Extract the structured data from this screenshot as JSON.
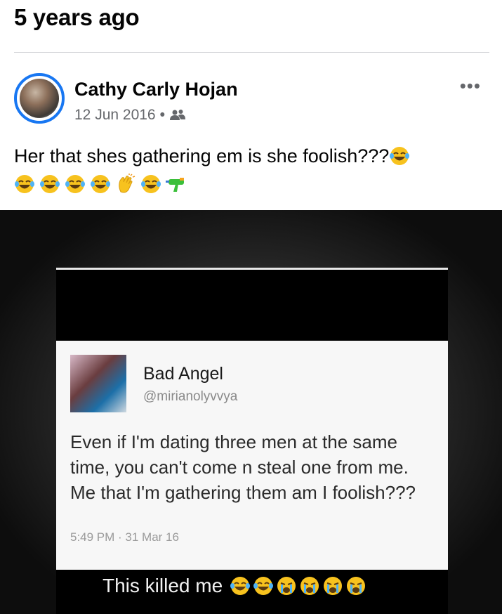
{
  "memory": {
    "heading": "5 years ago"
  },
  "post": {
    "author": "Cathy Carly Hojan",
    "date": "12 Jun 2016",
    "separator": "•",
    "audience_icon": "friends-icon",
    "more_label": "•••",
    "text": "Her that shes gathering em is she foolish???",
    "emojis_inline": [
      "laughing-emoji"
    ],
    "emojis_row": [
      "laughing-emoji",
      "laughing-emoji",
      "laughing-emoji",
      "laughing-emoji",
      "clapping-emoji",
      "laughing-emoji",
      "water-gun-emoji"
    ]
  },
  "image": {
    "tweet": {
      "name": "Bad Angel",
      "handle": "@mirianolyvvya",
      "body": "Even if I'm dating three men at the same time, you can't come n steal one from me. Me that I'm gathering them am I foolish???",
      "time": "5:49 PM · 31 Mar 16"
    },
    "caption": {
      "text": "This killed me",
      "emojis": [
        "laughing-emoji",
        "laughing-emoji",
        "crying-emoji",
        "crying-emoji",
        "crying-emoji",
        "crying-emoji"
      ]
    }
  },
  "colors": {
    "accent": "#1877f2",
    "meta": "#65676b",
    "emoji": "#f7c21e"
  }
}
